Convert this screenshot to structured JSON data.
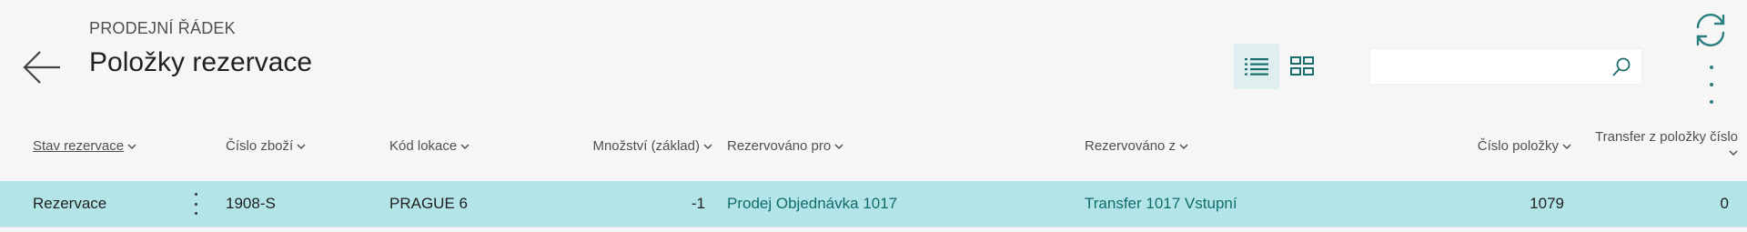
{
  "header": {
    "caption": "PRODEJNÍ ŘÁDEK",
    "title": "Položky rezervace"
  },
  "search": {
    "value": "",
    "placeholder": ""
  },
  "columns": [
    {
      "key": "stav",
      "label": "Stav rezervace"
    },
    {
      "key": "cislo_zbozi",
      "label": "Číslo zboží"
    },
    {
      "key": "kod_lokace",
      "label": "Kód lokace"
    },
    {
      "key": "mnozstvi",
      "label": "Množství (základ)"
    },
    {
      "key": "rezervovano_pro",
      "label": "Rezervováno pro"
    },
    {
      "key": "rezervovano_z",
      "label": "Rezervováno z"
    },
    {
      "key": "cislo_polozky",
      "label": "Číslo položky"
    },
    {
      "key": "transfer",
      "label": "Transfer z položky číslo"
    }
  ],
  "rows": [
    {
      "stav": "Rezervace",
      "cislo_zbozi": "1908-S",
      "kod_lokace": "PRAGUE 6",
      "mnozstvi": "-1",
      "rezervovano_pro": "Prodej Objednávka 1017",
      "rezervovano_z": "Transfer 1017 Vstupní",
      "cislo_polozky": "1079",
      "transfer": "0"
    }
  ],
  "icons": {
    "back": "arrow-left-icon",
    "list_view": "list-view-icon",
    "tile_view": "tile-view-icon",
    "search": "search-icon",
    "refresh": "refresh-icon",
    "more": "more-vertical-icon"
  },
  "colors": {
    "accent": "#2b7f7f",
    "row_selected": "#b3e5e8",
    "link": "#106b6b"
  }
}
